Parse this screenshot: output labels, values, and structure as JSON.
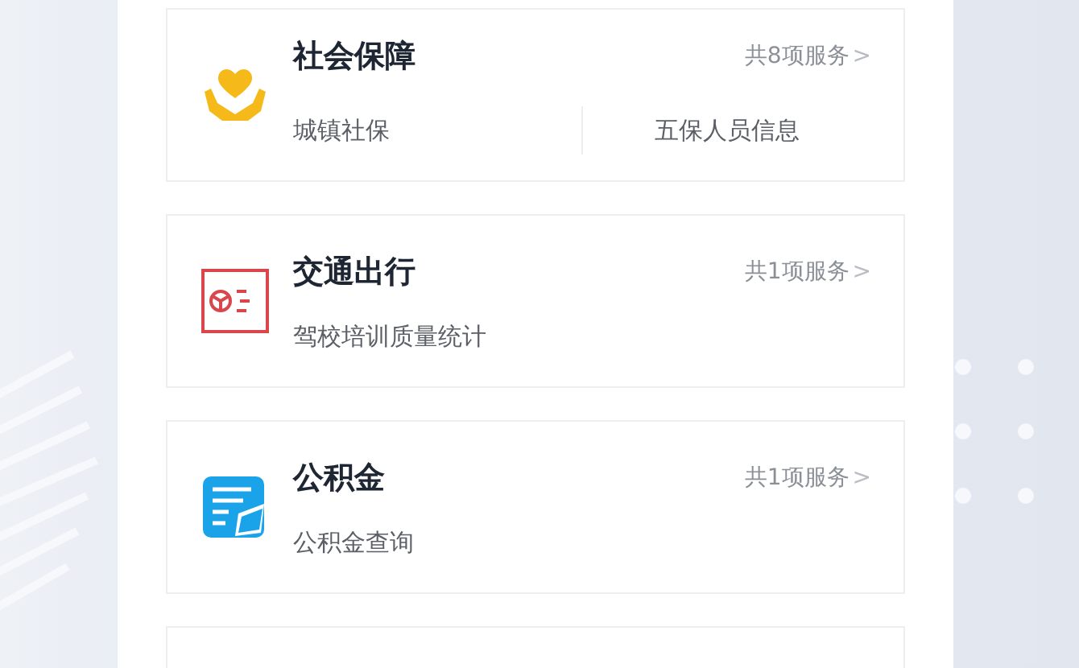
{
  "categories": [
    {
      "kind": "hands-heart",
      "title": "社会保障",
      "count": "共8项服务",
      "chevron": ">",
      "services": [
        "城镇社保",
        "五保人员信息"
      ]
    },
    {
      "kind": "license",
      "title": "交通出行",
      "count": "共1项服务",
      "chevron": ">",
      "services": [
        "驾校培训质量统计"
      ]
    },
    {
      "kind": "notes",
      "title": "公积金",
      "count": "共1项服务",
      "chevron": ">",
      "services": [
        "公积金查询"
      ]
    }
  ]
}
